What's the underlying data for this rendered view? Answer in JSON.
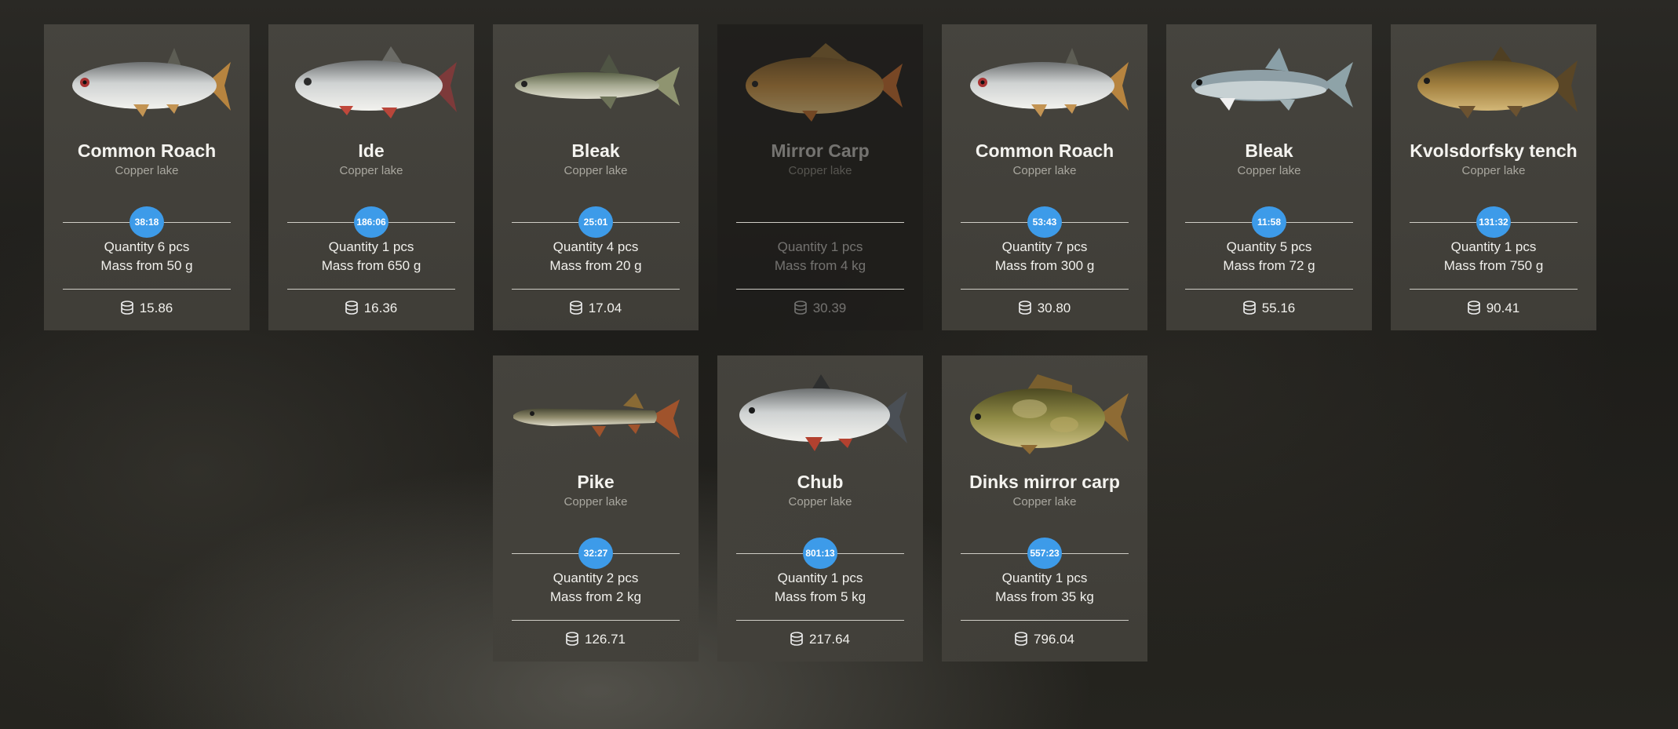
{
  "currency_icon": "coin-stack-icon",
  "accent_color": "#3d9be9",
  "cards": [
    {
      "name": "Common Roach",
      "location": "Copper lake",
      "timer": "38:18",
      "quantity": "Quantity 6 pcs",
      "mass": "Mass from 50 g",
      "price": "15.86",
      "fish_icon": "roach-icon",
      "available": true
    },
    {
      "name": "Ide",
      "location": "Copper lake",
      "timer": "186:06",
      "quantity": "Quantity 1 pcs",
      "mass": "Mass from 650 g",
      "price": "16.36",
      "fish_icon": "ide-icon",
      "available": true
    },
    {
      "name": "Bleak",
      "location": "Copper lake",
      "timer": "25:01",
      "quantity": "Quantity 4 pcs",
      "mass": "Mass from 20 g",
      "price": "17.04",
      "fish_icon": "bleak-icon",
      "available": true
    },
    {
      "name": "Mirror Carp",
      "location": "Copper lake",
      "timer": "",
      "quantity": "Quantity 1 pcs",
      "mass": "Mass from 4 kg",
      "price": "30.39",
      "fish_icon": "mirror-carp-icon",
      "available": false
    },
    {
      "name": "Common Roach",
      "location": "Copper lake",
      "timer": "53:43",
      "quantity": "Quantity 7 pcs",
      "mass": "Mass from 300 g",
      "price": "30.80",
      "fish_icon": "roach-icon",
      "available": true
    },
    {
      "name": "Bleak",
      "location": "Copper lake",
      "timer": "11:58",
      "quantity": "Quantity 5 pcs",
      "mass": "Mass from 72 g",
      "price": "55.16",
      "fish_icon": "bleak-icon",
      "available": true
    },
    {
      "name": "Kvolsdorfsky tench",
      "location": "Copper lake",
      "timer": "131:32",
      "quantity": "Quantity 1 pcs",
      "mass": "Mass from 750 g",
      "price": "90.41",
      "fish_icon": "tench-icon",
      "available": true
    },
    {
      "name": "Pike",
      "location": "Copper lake",
      "timer": "32:27",
      "quantity": "Quantity 2 pcs",
      "mass": "Mass from 2 kg",
      "price": "126.71",
      "fish_icon": "pike-icon",
      "available": true
    },
    {
      "name": "Chub",
      "location": "Copper lake",
      "timer": "801:13",
      "quantity": "Quantity 1 pcs",
      "mass": "Mass from 5 kg",
      "price": "217.64",
      "fish_icon": "chub-icon",
      "available": true
    },
    {
      "name": "Dinks mirror carp",
      "location": "Copper lake",
      "timer": "557:23",
      "quantity": "Quantity 1 pcs",
      "mass": "Mass from 35 kg",
      "price": "796.04",
      "fish_icon": "mirror-carp-icon",
      "available": true
    }
  ]
}
